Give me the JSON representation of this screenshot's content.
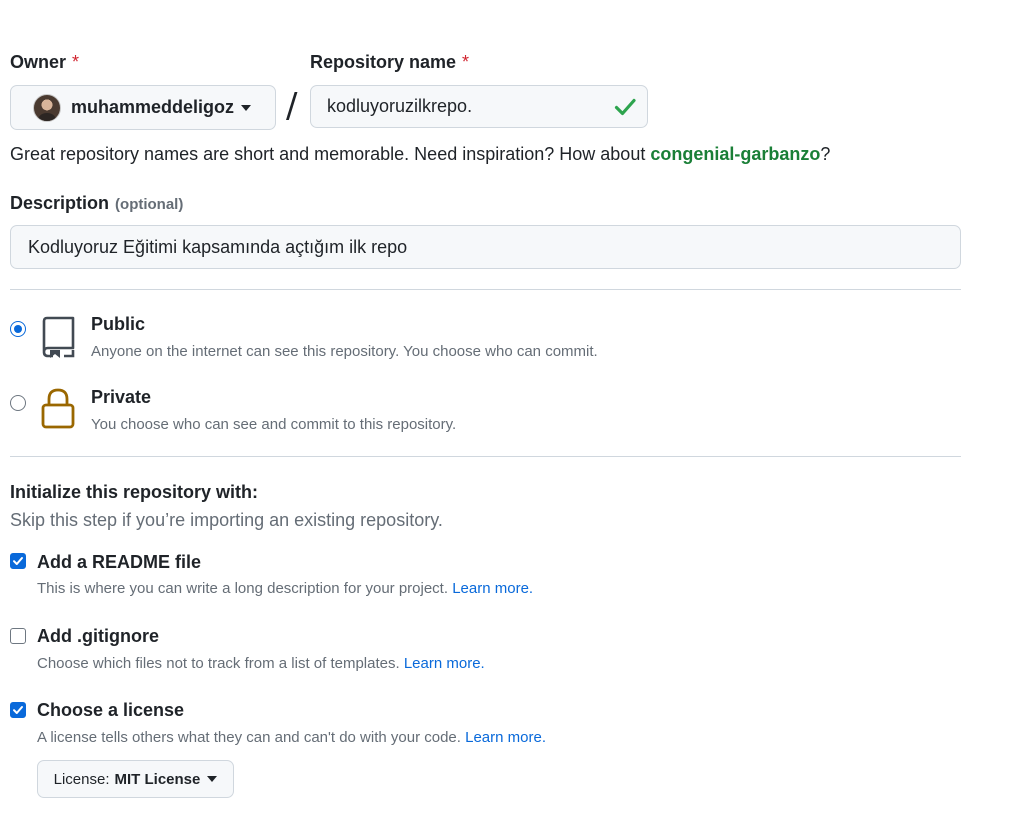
{
  "owner": {
    "label": "Owner",
    "required_mark": "*",
    "username": "muhammeddeligoz"
  },
  "separator": "/",
  "repository": {
    "label": "Repository name",
    "required_mark": "*",
    "value": "kodluyoruzilkrepo.",
    "valid_icon": "check-icon",
    "hint_prefix": "Great repository names are short and memorable. Need inspiration? How about ",
    "suggestion": "congenial-garbanzo",
    "hint_suffix": "?"
  },
  "description": {
    "label": "Description",
    "optional_label": "(optional)",
    "value": "Kodluyoruz Eğitimi kapsamında açtığım ilk repo"
  },
  "visibility": {
    "public": {
      "title": "Public",
      "description": "Anyone on the internet can see this repository. You choose who can commit.",
      "icon": "repo-icon",
      "selected": true
    },
    "private": {
      "title": "Private",
      "description": "You choose who can see and commit to this repository.",
      "icon": "lock-icon",
      "selected": false
    }
  },
  "initialize": {
    "title": "Initialize this repository with:",
    "subtitle": "Skip this step if you’re importing an existing repository.",
    "readme": {
      "label": "Add a README file",
      "description": "This is where you can write a long description for your project.",
      "link": "Learn more.",
      "checked": true
    },
    "gitignore": {
      "label": "Add .gitignore",
      "description": "Choose which files not to track from a list of templates.",
      "link": "Learn more.",
      "checked": false
    },
    "license": {
      "label": "Choose a license",
      "description": "A license tells others what they can and can't do with your code.",
      "link": "Learn more.",
      "checked": true,
      "select_prefix": "License:",
      "select_value": "MIT License"
    }
  },
  "colors": {
    "accent": "#0969da",
    "success": "#1a7f37",
    "required": "#d1242f",
    "lock": "#9a6700"
  }
}
